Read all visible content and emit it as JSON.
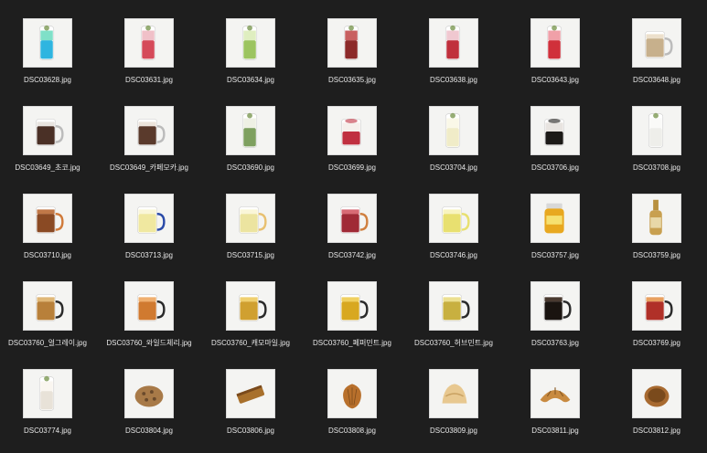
{
  "files": [
    {
      "name": "DSC03628.jpg",
      "icon": "blue-soda-drink",
      "kind": "tall",
      "c1": "#2fb5e0",
      "c2": "#7fe0c8",
      "handle": false
    },
    {
      "name": "DSC03631.jpg",
      "icon": "red-soda-drink",
      "kind": "tall",
      "c1": "#d54a5a",
      "c2": "#f0c0c8",
      "handle": false
    },
    {
      "name": "DSC03634.jpg",
      "icon": "green-soda-drink",
      "kind": "tall",
      "c1": "#9cc460",
      "c2": "#dfeec0",
      "handle": false
    },
    {
      "name": "DSC03635.jpg",
      "icon": "red-tea-drink",
      "kind": "tall",
      "c1": "#8c2a2a",
      "c2": "#c86060",
      "handle": false
    },
    {
      "name": "DSC03638.jpg",
      "icon": "berry-soda-drink",
      "kind": "tall",
      "c1": "#c0303c",
      "c2": "#f0c8d0",
      "handle": false
    },
    {
      "name": "DSC03643.jpg",
      "icon": "red-ade-drink",
      "kind": "tall",
      "c1": "#d0303a",
      "c2": "#f0a0a8",
      "handle": false
    },
    {
      "name": "DSC03648.jpg",
      "icon": "milk-tea-drink",
      "kind": "mug",
      "c1": "#c7b08c",
      "c2": "#ece0cc",
      "handle": true
    },
    {
      "name": "DSC03649_초코.jpg",
      "icon": "choco-drink",
      "kind": "mug",
      "c1": "#4a3026",
      "c2": "#e8e4e0",
      "handle": true
    },
    {
      "name": "DSC03649_카페모카.jpg",
      "icon": "mocha-drink",
      "kind": "mug",
      "c1": "#5a3a2c",
      "c2": "#ece4dc",
      "handle": true
    },
    {
      "name": "DSC03690.jpg",
      "icon": "matcha-latte-drink",
      "kind": "tall",
      "c1": "#7ea060",
      "c2": "#eef0e4",
      "handle": false
    },
    {
      "name": "DSC03699.jpg",
      "icon": "strawberry-latte-drink",
      "kind": "short",
      "c1": "#c03040",
      "c2": "#f6f0ec",
      "handle": false
    },
    {
      "name": "DSC03704.jpg",
      "icon": "banana-milk-drink",
      "kind": "tall",
      "c1": "#f0ecc8",
      "c2": "#faf8e8",
      "handle": false
    },
    {
      "name": "DSC03706.jpg",
      "icon": "cold-brew-drink",
      "kind": "short",
      "c1": "#1c1a18",
      "c2": "#e8e4e0",
      "handle": false
    },
    {
      "name": "DSC03708.jpg",
      "icon": "milk-drink",
      "kind": "tall",
      "c1": "#eeeeea",
      "c2": "#fafaf8",
      "handle": false
    },
    {
      "name": "DSC03710.jpg",
      "icon": "black-tea-drink",
      "kind": "mug",
      "c1": "#8a4a24",
      "c2": "#c07848",
      "handle": true,
      "handleColor": "#d07a3a"
    },
    {
      "name": "DSC03713.jpg",
      "icon": "lemon-tea-drink",
      "kind": "mug",
      "c1": "#f0e8a0",
      "c2": "#faf6d8",
      "handle": true,
      "handleColor": "#2a4aa8"
    },
    {
      "name": "DSC03715.jpg",
      "icon": "citron-tea-drink",
      "kind": "mug",
      "c1": "#ece4a0",
      "c2": "#faf6d8",
      "handle": true,
      "handleColor": "#e8c070"
    },
    {
      "name": "DSC03742.jpg",
      "icon": "berry-tea-drink",
      "kind": "mug",
      "c1": "#a02a36",
      "c2": "#d86a74",
      "handle": true,
      "handleColor": "#d08040"
    },
    {
      "name": "DSC03746.jpg",
      "icon": "yuzu-ade-drink",
      "kind": "mug",
      "c1": "#e8e070",
      "c2": "#f8f4c0",
      "handle": true,
      "handleColor": "#e8e070"
    },
    {
      "name": "DSC03757.jpg",
      "icon": "honey-jar",
      "kind": "jar",
      "c1": "#e8a820",
      "c2": "#f6e070",
      "handle": false
    },
    {
      "name": "DSC03759.jpg",
      "icon": "syrup-bottle",
      "kind": "bottle",
      "c1": "#c8a050",
      "c2": "#e8d8a8",
      "handle": false
    },
    {
      "name": "DSC03760_얼그레이.jpg",
      "icon": "earl-grey-tea-drink",
      "kind": "mug",
      "c1": "#b8803a",
      "c2": "#e0b878",
      "handle": true,
      "handleColor": "#2a2a2a"
    },
    {
      "name": "DSC03760_와일드체리.jpg",
      "icon": "wild-cherry-tea-drink",
      "kind": "mug",
      "c1": "#d07a30",
      "c2": "#f0b070",
      "handle": true,
      "handleColor": "#2a2a2a"
    },
    {
      "name": "DSC03760_캐모마일.jpg",
      "icon": "chamomile-tea-drink",
      "kind": "mug",
      "c1": "#d0a030",
      "c2": "#f0d070",
      "handle": true,
      "handleColor": "#2a2a2a"
    },
    {
      "name": "DSC03760_페퍼민트.jpg",
      "icon": "peppermint-tea-drink",
      "kind": "mug",
      "c1": "#d8a820",
      "c2": "#f0d060",
      "handle": true,
      "handleColor": "#2a2a2a"
    },
    {
      "name": "DSC03760_허브민트.jpg",
      "icon": "herb-mint-tea-drink",
      "kind": "mug",
      "c1": "#c8b040",
      "c2": "#ece090",
      "handle": true,
      "handleColor": "#2a2a2a"
    },
    {
      "name": "DSC03763.jpg",
      "icon": "americano-drink",
      "kind": "mug",
      "c1": "#1a1410",
      "c2": "#4a3a30",
      "handle": true,
      "handleColor": "#2a2a2a"
    },
    {
      "name": "DSC03769.jpg",
      "icon": "fruit-tea-drink",
      "kind": "mug",
      "c1": "#b03028",
      "c2": "#e8a060",
      "handle": true,
      "handleColor": "#2a2a2a"
    },
    {
      "name": "DSC03774.jpg",
      "icon": "vanilla-latte-drink",
      "kind": "tall",
      "c1": "#e8e2d8",
      "c2": "#faf6f0",
      "handle": false
    },
    {
      "name": "DSC03804.jpg",
      "icon": "cookie",
      "kind": "cookie",
      "c1": "#a87a48",
      "c2": "#6a4a2c",
      "handle": false
    },
    {
      "name": "DSC03806.jpg",
      "icon": "financier",
      "kind": "financier",
      "c1": "#a8702c",
      "c2": "#7a4a1c",
      "handle": false
    },
    {
      "name": "DSC03808.jpg",
      "icon": "madeleine",
      "kind": "madeleine",
      "c1": "#b8702c",
      "c2": "#7a4a1c",
      "handle": false
    },
    {
      "name": "DSC03809.jpg",
      "icon": "scone",
      "kind": "scone",
      "c1": "#e8c890",
      "c2": "#c8a060",
      "handle": false
    },
    {
      "name": "DSC03811.jpg",
      "icon": "croissant",
      "kind": "croissant",
      "c1": "#c88a40",
      "c2": "#8a5a24",
      "handle": false
    },
    {
      "name": "DSC03812.jpg",
      "icon": "tart",
      "kind": "tart",
      "c1": "#a86a30",
      "c2": "#7a4a1c",
      "handle": false
    }
  ]
}
